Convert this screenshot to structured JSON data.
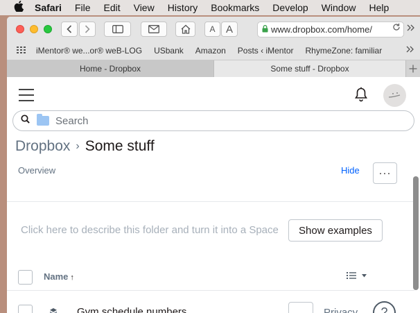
{
  "menubar": {
    "app": "Safari",
    "items": [
      "File",
      "Edit",
      "View",
      "History",
      "Bookmarks",
      "Develop",
      "Window",
      "Help"
    ]
  },
  "toolbar": {
    "font_small": "A",
    "font_large": "A",
    "url": "www.dropbox.com/home/"
  },
  "favorites": [
    "iMentor® we...or® weB-LOG",
    "USbank",
    "Amazon",
    "Posts ‹ iMentor",
    "RhymeZone: familiar"
  ],
  "tabs": [
    {
      "label": "Home - Dropbox"
    },
    {
      "label": "Some stuff - Dropbox"
    }
  ],
  "search": {
    "placeholder": "Search"
  },
  "breadcrumb": {
    "root": "Dropbox",
    "separator": "›",
    "current": "Some stuff"
  },
  "overview": {
    "label": "Overview",
    "hide": "Hide",
    "more": "···"
  },
  "description": {
    "placeholder": "Click here to describe this folder and turn it into a Space",
    "button": "Show examples"
  },
  "table": {
    "name_header": "Name",
    "sort_arrow": "↑"
  },
  "files": [
    {
      "name": "Gym schedule.numbers",
      "more": "···",
      "privacy": "Privacy"
    }
  ],
  "help": "?",
  "colors": {
    "accent": "#0061fe",
    "text": "#1e1919",
    "muted": "#637282"
  }
}
